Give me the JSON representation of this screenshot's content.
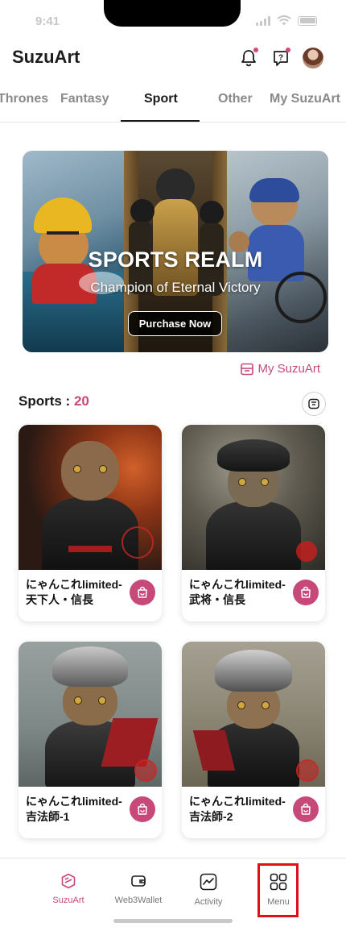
{
  "status_bar": {
    "time": "9:41"
  },
  "header": {
    "app_title": "SuzuArt",
    "icons": [
      "bell-icon",
      "help-chat-icon",
      "avatar"
    ]
  },
  "tabs": [
    {
      "label": "Thrones",
      "active": false
    },
    {
      "label": "Fantasy",
      "active": false
    },
    {
      "label": "Sport",
      "active": true
    },
    {
      "label": "Other",
      "active": false
    },
    {
      "label": "My SuzuArt",
      "active": false
    }
  ],
  "banner": {
    "title": "SPORTS REALM",
    "subtitle": "Champion of Eternal Victory",
    "button_label": "Purchase Now"
  },
  "my_link": {
    "label": "My SuzuArt",
    "icon": "wallet-card-icon"
  },
  "section": {
    "label": "Sports :",
    "count": "20",
    "filter_icon": "filter-icon"
  },
  "cards": [
    {
      "title": "にゃんこれlimited-天下人・信長",
      "icon": "shopping-bag-icon"
    },
    {
      "title": "にゃんこれlimited-武将・信長",
      "icon": "shopping-bag-icon"
    },
    {
      "title": "にゃんこれlimited-吉法師-1",
      "icon": "shopping-bag-icon"
    },
    {
      "title": "にゃんこれlimited-吉法師-2",
      "icon": "shopping-bag-icon"
    }
  ],
  "bottom_nav": [
    {
      "label": "SuzuArt",
      "icon": "suzuart-cube-icon",
      "active": true
    },
    {
      "label": "Web3Wallet",
      "icon": "wallet-icon",
      "active": false
    },
    {
      "label": "Activity",
      "icon": "activity-chart-icon",
      "active": false
    },
    {
      "label": "Menu",
      "icon": "grid-menu-icon",
      "active": false
    }
  ],
  "colors": {
    "accent": "#c6497a",
    "highlight_box": "#e0101a",
    "text_primary": "#1a1a1a",
    "text_muted": "#8a8a8a"
  }
}
